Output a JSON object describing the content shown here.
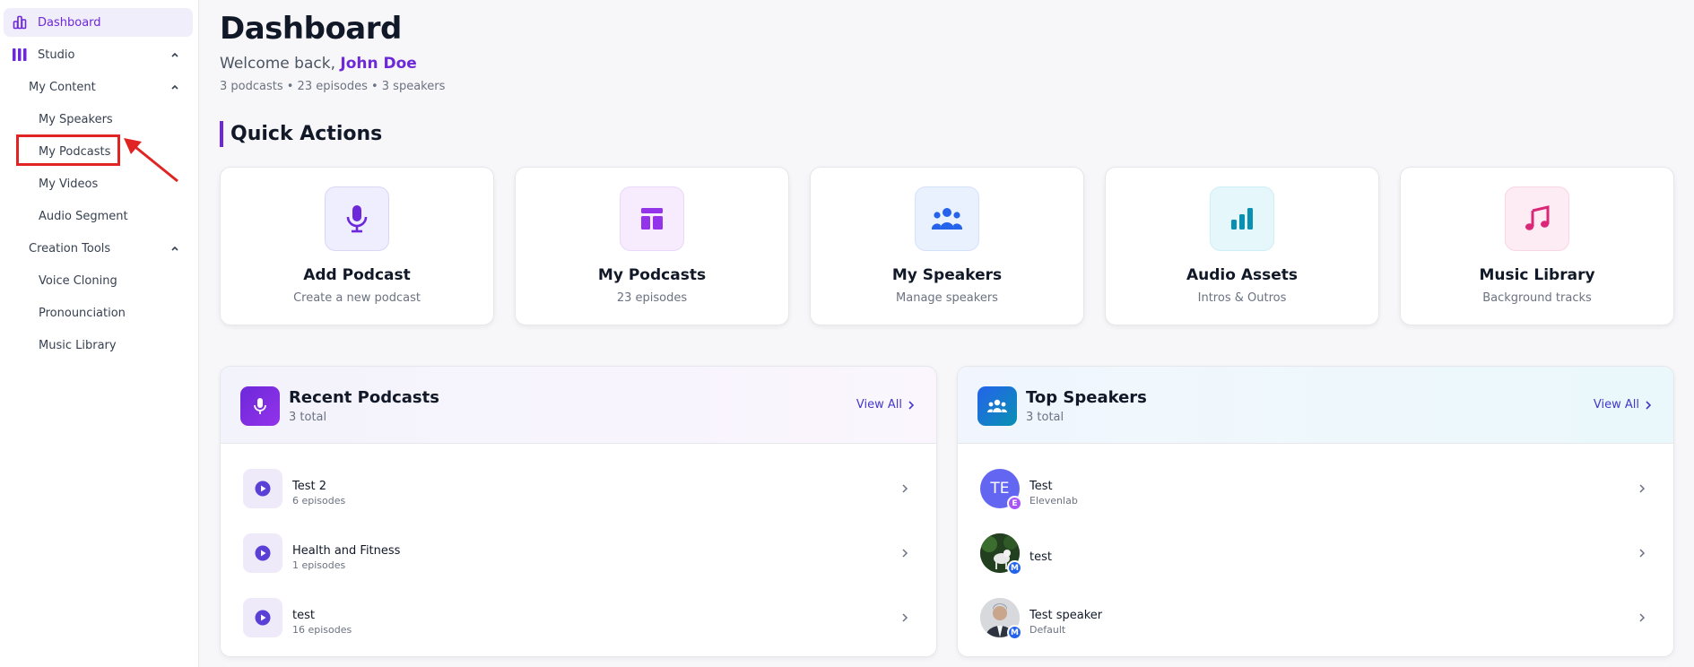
{
  "sidebar": {
    "dashboard": "Dashboard",
    "studio": "Studio",
    "my_content": "My Content",
    "my_speakers": "My Speakers",
    "my_podcasts": "My Podcasts",
    "my_videos": "My Videos",
    "audio_segment": "Audio Segment",
    "creation_tools": "Creation Tools",
    "voice_cloning": "Voice Cloning",
    "pronounciation": "Pronounciation",
    "music_library": "Music Library"
  },
  "header": {
    "title": "Dashboard",
    "welcome_prefix": "Welcome back,",
    "user_name": "John Doe",
    "stats": "3 podcasts • 23 episodes • 3 speakers"
  },
  "quick_actions": {
    "title": "Quick Actions",
    "cards": [
      {
        "title": "Add Podcast",
        "subtitle": "Create a new podcast",
        "icon": "microphone-icon",
        "color": "#6d28d9"
      },
      {
        "title": "My Podcasts",
        "subtitle": "23 episodes",
        "icon": "layout-icon",
        "color": "#9333ea"
      },
      {
        "title": "My Speakers",
        "subtitle": "Manage speakers",
        "icon": "users-icon",
        "color": "#2563eb"
      },
      {
        "title": "Audio Assets",
        "subtitle": "Intros & Outros",
        "icon": "bar-chart-icon",
        "color": "#0891b2"
      },
      {
        "title": "Music Library",
        "subtitle": "Background tracks",
        "icon": "music-note-icon",
        "color": "#db2777"
      }
    ]
  },
  "recent_podcasts": {
    "title": "Recent Podcasts",
    "subtitle": "3 total",
    "view_all": "View All",
    "items": [
      {
        "title": "Test 2",
        "subtitle": "6 episodes"
      },
      {
        "title": "Health and Fitness",
        "subtitle": "1 episodes"
      },
      {
        "title": "test",
        "subtitle": "16 episodes"
      }
    ]
  },
  "top_speakers": {
    "title": "Top Speakers",
    "subtitle": "3 total",
    "view_all": "View All",
    "items": [
      {
        "name": "Test",
        "subtitle": "Elevenlab",
        "initials": "TE",
        "badge": "E"
      },
      {
        "name": "test",
        "subtitle": "",
        "initials": "",
        "badge": "M"
      },
      {
        "name": "Test speaker",
        "subtitle": "Default",
        "initials": "",
        "badge": "M"
      }
    ]
  },
  "colors": {
    "accent": "#6d28d9",
    "annotation": "#e02424"
  }
}
